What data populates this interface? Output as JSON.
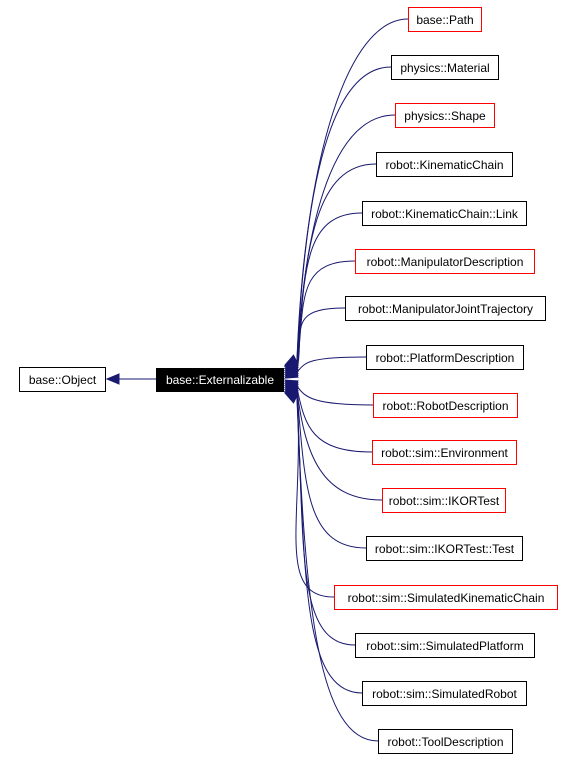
{
  "diagram": {
    "edge_color": "#191970",
    "incomplete_border_color": "#ff0000",
    "root": {
      "label": "base::Object",
      "incomplete": false
    },
    "current": {
      "label": "base::Externalizable"
    },
    "children": [
      {
        "label": "base::Path",
        "incomplete": true
      },
      {
        "label": "physics::Material",
        "incomplete": false
      },
      {
        "label": "physics::Shape",
        "incomplete": true
      },
      {
        "label": "robot::KinematicChain",
        "incomplete": false
      },
      {
        "label": "robot::KinematicChain::Link",
        "incomplete": false
      },
      {
        "label": "robot::ManipulatorDescription",
        "incomplete": true
      },
      {
        "label": "robot::ManipulatorJointTrajectory",
        "incomplete": false
      },
      {
        "label": "robot::PlatformDescription",
        "incomplete": false
      },
      {
        "label": "robot::RobotDescription",
        "incomplete": true
      },
      {
        "label": "robot::sim::Environment",
        "incomplete": true
      },
      {
        "label": "robot::sim::IKORTest",
        "incomplete": true
      },
      {
        "label": "robot::sim::IKORTest::Test",
        "incomplete": false
      },
      {
        "label": "robot::sim::SimulatedKinematicChain",
        "incomplete": true
      },
      {
        "label": "robot::sim::SimulatedPlatform",
        "incomplete": false
      },
      {
        "label": "robot::sim::SimulatedRobot",
        "incomplete": false
      },
      {
        "label": "robot::ToolDescription",
        "incomplete": false
      }
    ]
  }
}
